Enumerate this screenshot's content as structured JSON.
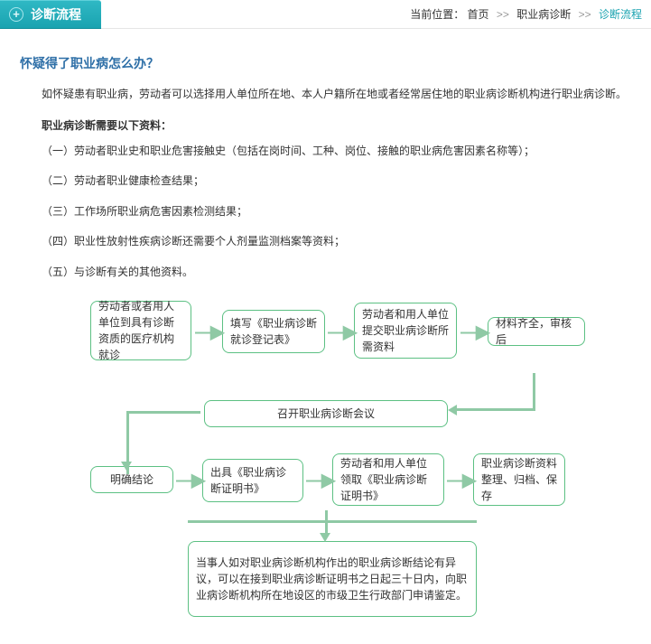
{
  "header": {
    "tab_title": "诊断流程",
    "loc_label": "当前位置：",
    "crumb_home": "首页",
    "crumb_mid": "职业病诊断",
    "crumb_current": "诊断流程",
    "sep": ">>"
  },
  "article": {
    "question": "怀疑得了职业病怎么办？",
    "intro": "如怀疑患有职业病，劳动者可以选择用人单位所在地、本人户籍所在地或者经常居住地的职业病诊断机构进行职业病诊断。",
    "materials_title": "职业病诊断需要以下资料：",
    "items": [
      "（一）劳动者职业史和职业危害接触史（包括在岗时间、工种、岗位、接触的职业病危害因素名称等）；",
      "（二）劳动者职业健康检查结果；",
      "（三）工作场所职业病危害因素检测结果；",
      "（四）职业性放射性疾病诊断还需要个人剂量监测档案等资料；",
      "（五）与诊断有关的其他资料。"
    ]
  },
  "flow": {
    "n1": "劳动者或者用人单位到具有诊断资质的医疗机构就诊",
    "n2": "填写《职业病诊断就诊登记表》",
    "n3": "劳动者和用人单位提交职业病诊断所需资料",
    "n4": "材料齐全，审核后",
    "n5": "召开职业病诊断会议",
    "n6": "明确结论",
    "n7": "出具《职业病诊断证明书》",
    "n8": "劳动者和用人单位领取《职业病诊断证明书》",
    "n9": "职业病诊断资料整理、归档、保存",
    "n10": "当事人如对职业病诊断机构作出的职业病诊断结论有异议，可以在接到职业病诊断证明书之日起三十日内，向职业病诊断机构所在地设区的市级卫生行政部门申请鉴定。"
  }
}
